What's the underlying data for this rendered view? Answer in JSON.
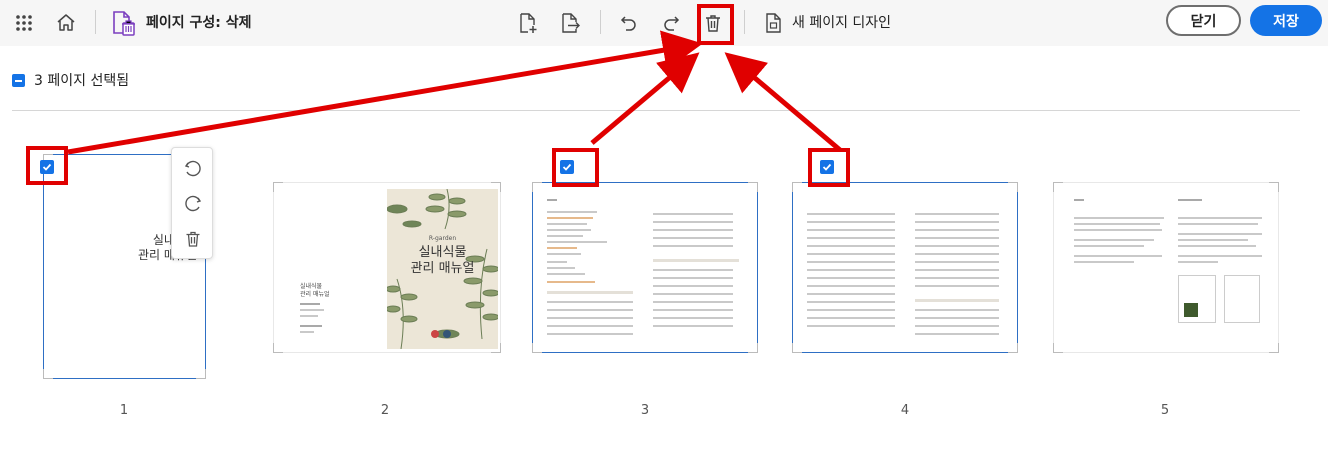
{
  "toolbar": {
    "title": "페이지 구성: 삭제",
    "new_page_design": "새 페이지 디자인",
    "close": "닫기",
    "save": "저장",
    "icons": [
      "apps-grid-icon",
      "home-icon",
      "organize-pages-icon",
      "insert-page-icon",
      "extract-page-icon",
      "undo-icon",
      "redo-icon",
      "delete-icon",
      "page-design-icon"
    ]
  },
  "selection": {
    "label": "3 페이지 선택됨"
  },
  "pages": [
    {
      "number": "1",
      "selected": true,
      "title_line1": "실내식물",
      "title_line2": "관리 매뉴얼"
    },
    {
      "number": "2",
      "selected": false,
      "cover_brand": "R-garden",
      "cover_line1": "실내식물",
      "cover_line2": "관리 매뉴얼",
      "left_line1": "실내식물",
      "left_line2": "관리 매뉴얼"
    },
    {
      "number": "3",
      "selected": true
    },
    {
      "number": "4",
      "selected": true
    },
    {
      "number": "5",
      "selected": false
    }
  ],
  "page1_popover": {
    "icons": [
      "rotate-left-icon",
      "rotate-right-icon",
      "delete-icon"
    ]
  },
  "colors": {
    "accent": "#1473e6",
    "annotation_red": "#e00000",
    "toolbar_bg": "#f6f6f6"
  }
}
